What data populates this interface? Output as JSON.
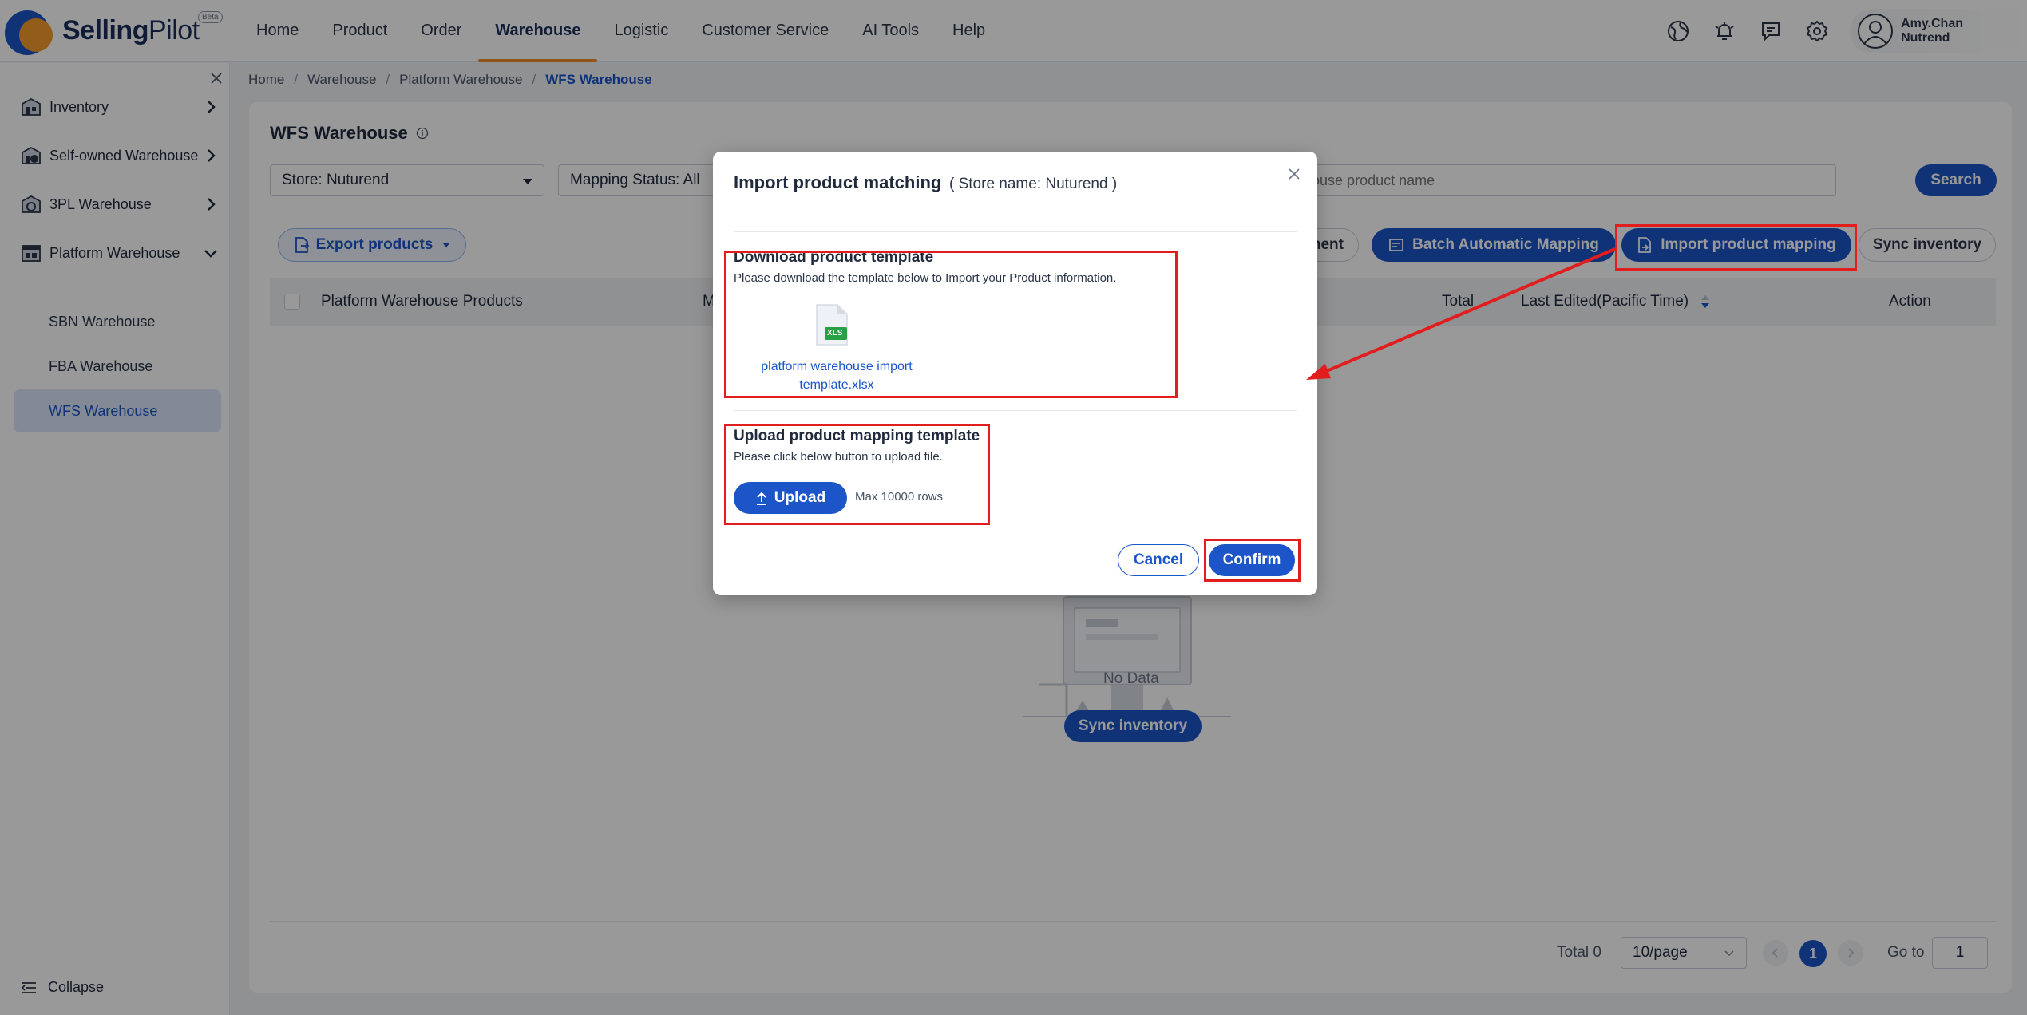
{
  "brand": {
    "name_bold": "Selling",
    "name_light": "Pilot",
    "badge": "Beta"
  },
  "nav": [
    {
      "label": "Home",
      "active": false
    },
    {
      "label": "Product",
      "active": false
    },
    {
      "label": "Order",
      "active": false
    },
    {
      "label": "Warehouse",
      "active": true
    },
    {
      "label": "Logistic",
      "active": false
    },
    {
      "label": "Customer Service",
      "active": false
    },
    {
      "label": "AI Tools",
      "active": false
    },
    {
      "label": "Help",
      "active": false
    }
  ],
  "top_icons": [
    "globe-icon",
    "bell-icon",
    "message-icon",
    "gear-icon"
  ],
  "user": {
    "name": "Amy.Chan",
    "org": "Nutrend"
  },
  "sidebar": {
    "items": [
      {
        "label": "Inventory",
        "icon": "inventory-icon"
      },
      {
        "label": "Self-owned Warehouse",
        "icon": "warehouse-icon"
      },
      {
        "label": "3PL Warehouse",
        "icon": "globe-warehouse-icon"
      },
      {
        "label": "Platform Warehouse",
        "icon": "platform-icon"
      }
    ],
    "sub_items": [
      {
        "label": "SBN Warehouse",
        "active": false
      },
      {
        "label": "FBA Warehouse",
        "active": false
      },
      {
        "label": "WFS Warehouse",
        "active": true
      }
    ],
    "collapse_label": "Collapse"
  },
  "breadcrumb": [
    "Home",
    "Warehouse",
    "Platform Warehouse",
    "WFS Warehouse"
  ],
  "page": {
    "title": "WFS Warehouse",
    "store_select": "Store: Nuturend",
    "mapping_select": "Mapping Status: All",
    "search_placeholder": "arehouse product name",
    "search_button": "Search",
    "export_button": "Export products",
    "partial_button": "ment",
    "batch_button": "Batch Automatic Mapping",
    "import_button": "Import product mapping",
    "sync_button": "Sync inventory",
    "columns": {
      "products": "Platform Warehouse Products",
      "partial": "M",
      "total": "Total",
      "last_edited": "Last Edited(Pacific Time)",
      "action": "Action"
    },
    "no_data": "No Data",
    "sync_empty_button": "Sync inventory",
    "pager": {
      "total": "Total 0",
      "page_size": "10/page",
      "current_page": "1",
      "goto_label": "Go to",
      "goto_value": "1"
    }
  },
  "modal": {
    "title": "Import product matching",
    "subtitle": "( Store name: Nuturend )",
    "download_title": "Download product template",
    "download_desc": "Please download the template below to Import your Product information.",
    "file_badge": "XLS",
    "file_name_line1": "platform warehouse import",
    "file_name_line2": "template.xlsx",
    "upload_title": "Upload product mapping template",
    "upload_desc": "Please click below button to upload file.",
    "upload_button": "Upload",
    "max_rows": "Max 10000 rows",
    "cancel": "Cancel",
    "confirm": "Confirm"
  },
  "colors": {
    "primary": "#1b55c8",
    "accent": "#f08c2b",
    "highlight": "#e11d1d"
  }
}
